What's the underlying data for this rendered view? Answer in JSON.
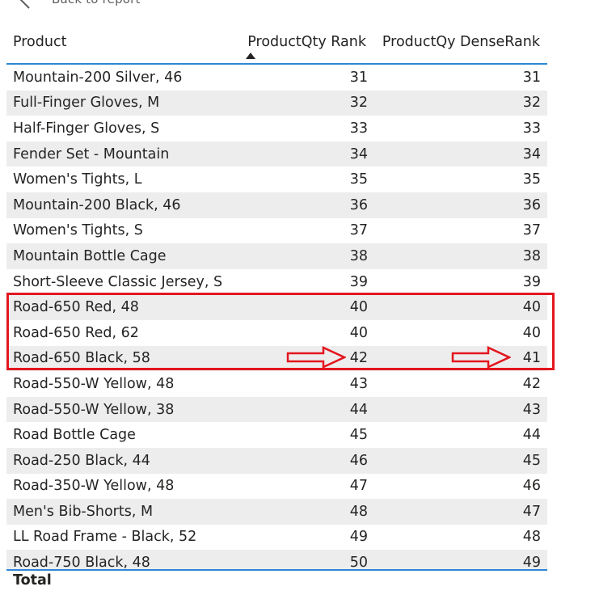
{
  "nav": {
    "back_label": "Back to report"
  },
  "table": {
    "columns": [
      "Product",
      "ProductQty Rank",
      "ProductQy DenseRank"
    ],
    "sort": {
      "column": "ProductQty Rank",
      "direction": "ascending"
    },
    "rows": [
      {
        "product": "Mountain-200 Silver, 46",
        "rank": "31",
        "dense": "31"
      },
      {
        "product": "Full-Finger Gloves, M",
        "rank": "32",
        "dense": "32"
      },
      {
        "product": "Half-Finger Gloves, S",
        "rank": "33",
        "dense": "33"
      },
      {
        "product": "Fender Set - Mountain",
        "rank": "34",
        "dense": "34"
      },
      {
        "product": "Women's Tights, L",
        "rank": "35",
        "dense": "35"
      },
      {
        "product": "Mountain-200 Black, 46",
        "rank": "36",
        "dense": "36"
      },
      {
        "product": "Women's Tights, S",
        "rank": "37",
        "dense": "37"
      },
      {
        "product": "Mountain Bottle Cage",
        "rank": "38",
        "dense": "38"
      },
      {
        "product": "Short-Sleeve Classic Jersey, S",
        "rank": "39",
        "dense": "39"
      },
      {
        "product": "Road-650 Red, 48",
        "rank": "40",
        "dense": "40"
      },
      {
        "product": "Road-650 Red, 62",
        "rank": "40",
        "dense": "40"
      },
      {
        "product": "Road-650 Black, 58",
        "rank": "42",
        "dense": "41"
      },
      {
        "product": "Road-550-W Yellow, 48",
        "rank": "43",
        "dense": "42"
      },
      {
        "product": "Road-550-W Yellow, 38",
        "rank": "44",
        "dense": "43"
      },
      {
        "product": "Road Bottle Cage",
        "rank": "45",
        "dense": "44"
      },
      {
        "product": "Road-250 Black, 44",
        "rank": "46",
        "dense": "45"
      },
      {
        "product": "Road-350-W Yellow, 48",
        "rank": "47",
        "dense": "46"
      },
      {
        "product": "Men's Bib-Shorts, M",
        "rank": "48",
        "dense": "47"
      },
      {
        "product": "LL Road Frame - Black, 52",
        "rank": "49",
        "dense": "48"
      },
      {
        "product": "Road-750 Black, 48",
        "rank": "50",
        "dense": "49"
      }
    ],
    "total_label": "Total"
  },
  "annotation": {
    "highlight_color": "#e3161f",
    "accent_color": "#2b88d8"
  }
}
